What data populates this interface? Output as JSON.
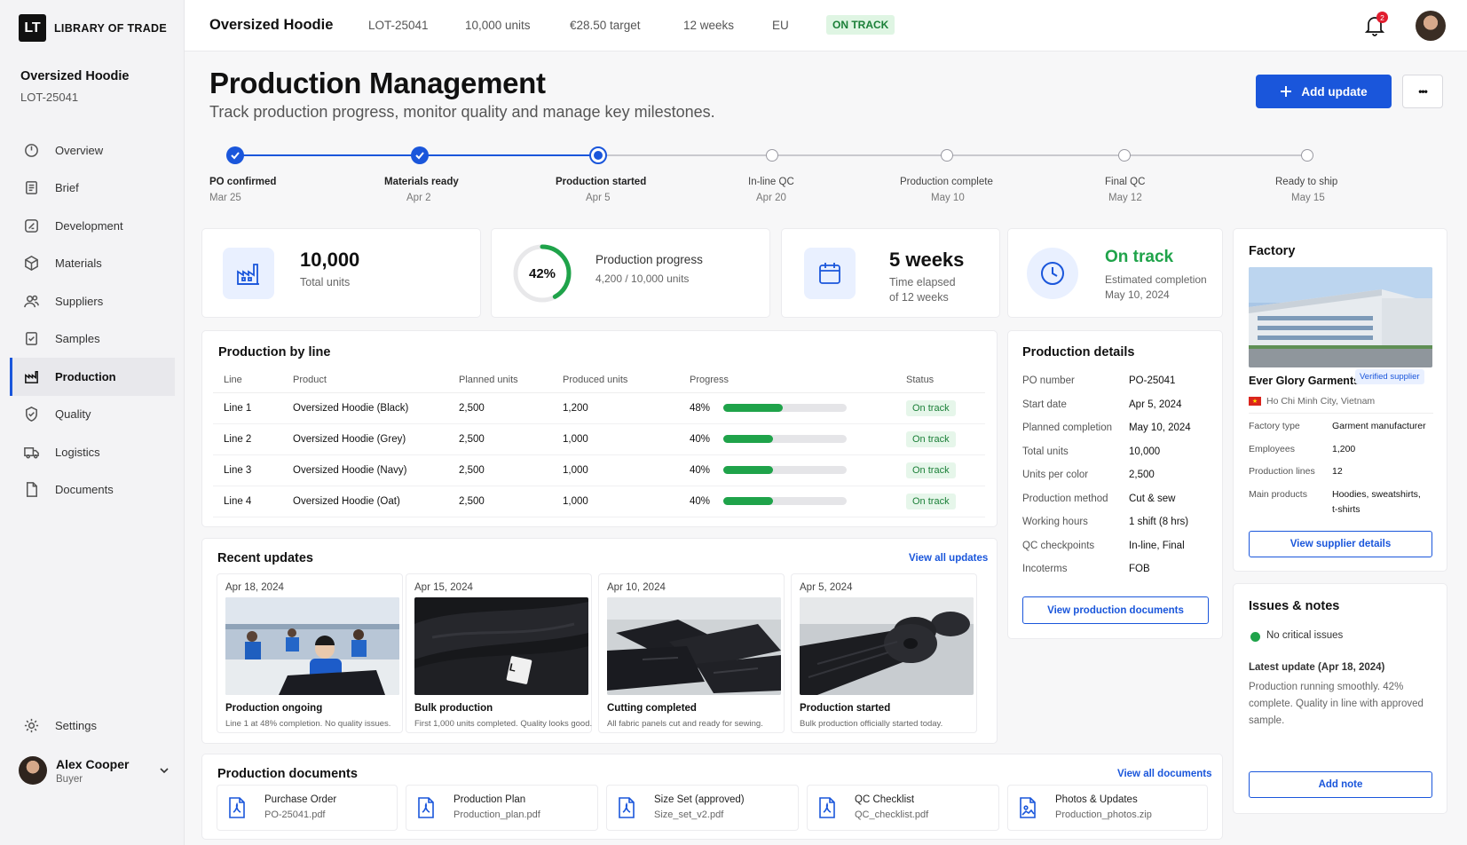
{
  "brand": {
    "mark": "LT",
    "name": "LIBRARY OF TRADE"
  },
  "project": {
    "name": "Oversized Hoodie",
    "code": "LOT-25041"
  },
  "sidebar": {
    "items": [
      {
        "label": "Overview",
        "icon": "overview-icon"
      },
      {
        "label": "Brief",
        "icon": "brief-icon"
      },
      {
        "label": "Development",
        "icon": "development-icon"
      },
      {
        "label": "Materials",
        "icon": "materials-icon"
      },
      {
        "label": "Suppliers",
        "icon": "suppliers-icon"
      },
      {
        "label": "Samples",
        "icon": "samples-icon"
      },
      {
        "label": "Production",
        "icon": "production-icon",
        "active": true
      },
      {
        "label": "Quality",
        "icon": "quality-icon"
      },
      {
        "label": "Logistics",
        "icon": "logistics-icon"
      },
      {
        "label": "Documents",
        "icon": "documents-icon"
      }
    ],
    "settings": "Settings",
    "user": {
      "name": "Alex Cooper",
      "role": "Buyer"
    }
  },
  "topbar": {
    "title": "Oversized Hoodie",
    "code": "LOT-25041",
    "units": "10,000 units",
    "target": "€28.50 target",
    "duration": "12 weeks",
    "region": "EU",
    "status": "ON TRACK",
    "notifications": "2"
  },
  "page": {
    "title": "Production Management",
    "subtitle": "Track production progress, monitor quality and manage key milestones.",
    "add_update": "Add update",
    "more": "•••"
  },
  "milestones": [
    {
      "label": "PO confirmed",
      "date": "Mar 25",
      "state": "done"
    },
    {
      "label": "Materials ready",
      "date": "Apr 2",
      "state": "done"
    },
    {
      "label": "Production started",
      "date": "Apr 5",
      "state": "current"
    },
    {
      "label": "In-line QC",
      "date": "Apr 20",
      "state": "todo"
    },
    {
      "label": "Production complete",
      "date": "May 10",
      "state": "todo"
    },
    {
      "label": "Final QC",
      "date": "May 12",
      "state": "todo"
    },
    {
      "label": "Ready to ship",
      "date": "May 15",
      "state": "todo"
    }
  ],
  "stats": {
    "total": {
      "value": "10,000",
      "label": "Total units"
    },
    "progress": {
      "percent": "42%",
      "fraction": 0.42,
      "label": "Production progress",
      "detail": "4,200 / 10,000 units"
    },
    "time": {
      "value": "5 weeks",
      "label1": "Time elapsed",
      "label2": "of 12 weeks"
    },
    "status": {
      "value": "On track",
      "label": "Estimated completion",
      "date": "May 10, 2024"
    }
  },
  "production_by_line": {
    "title": "Production by line",
    "headers": [
      "Line",
      "Product",
      "Planned units",
      "Produced units",
      "Progress",
      "Status"
    ],
    "rows": [
      {
        "line": "Line 1",
        "product": "Oversized Hoodie (Black)",
        "planned": "2,500",
        "produced": "1,200",
        "progress": "48%",
        "fraction": 0.48,
        "status": "On track"
      },
      {
        "line": "Line 2",
        "product": "Oversized Hoodie (Grey)",
        "planned": "2,500",
        "produced": "1,000",
        "progress": "40%",
        "fraction": 0.4,
        "status": "On track"
      },
      {
        "line": "Line 3",
        "product": "Oversized Hoodie (Navy)",
        "planned": "2,500",
        "produced": "1,000",
        "progress": "40%",
        "fraction": 0.4,
        "status": "On track"
      },
      {
        "line": "Line 4",
        "product": "Oversized Hoodie (Oat)",
        "planned": "2,500",
        "produced": "1,000",
        "progress": "40%",
        "fraction": 0.4,
        "status": "On track"
      }
    ]
  },
  "recent_updates": {
    "title": "Recent updates",
    "view_all": "View all updates",
    "items": [
      {
        "date": "Apr 18, 2024",
        "title": "Production ongoing",
        "desc": "Line 1 at 48% completion. No quality issues."
      },
      {
        "date": "Apr 15, 2024",
        "title": "Bulk production",
        "desc": "First 1,000 units completed. Quality looks good.",
        "tag": "L"
      },
      {
        "date": "Apr 10, 2024",
        "title": "Cutting completed",
        "desc": "All fabric panels cut and ready for sewing."
      },
      {
        "date": "Apr 5, 2024",
        "title": "Production started",
        "desc": "Bulk production officially started today."
      }
    ]
  },
  "production_details": {
    "title": "Production details",
    "rows": [
      {
        "k": "PO number",
        "v": "PO-25041"
      },
      {
        "k": "Start date",
        "v": "Apr 5, 2024"
      },
      {
        "k": "Planned completion",
        "v": "May 10, 2024"
      },
      {
        "k": "Total units",
        "v": "10,000"
      },
      {
        "k": "Units per color",
        "v": "2,500"
      },
      {
        "k": "Production method",
        "v": "Cut & sew"
      },
      {
        "k": "Working hours",
        "v": "1 shift (8 hrs)"
      },
      {
        "k": "QC checkpoints",
        "v": "In-line, Final"
      },
      {
        "k": "Incoterms",
        "v": "FOB"
      }
    ],
    "button": "View production documents"
  },
  "factory": {
    "title": "Factory",
    "name": "Ever Glory Garments",
    "verified": "Verified supplier",
    "location": "Ho Chi Minh City, Vietnam",
    "rows": [
      {
        "k": "Factory type",
        "v": "Garment manufacturer"
      },
      {
        "k": "Employees",
        "v": "1,200"
      },
      {
        "k": "Production lines",
        "v": "12"
      },
      {
        "k": "Main products",
        "v1": "Hoodies, sweatshirts,",
        "v2": "t-shirts"
      }
    ],
    "button": "View supplier details"
  },
  "issues": {
    "title": "Issues & notes",
    "status": "No critical issues",
    "latest_title": "Latest update (Apr 18, 2024)",
    "latest_lines": [
      "Production running smoothly. 42%",
      "complete. Quality in line with approved",
      "sample."
    ],
    "button": "Add note"
  },
  "documents": {
    "title": "Production documents",
    "view_all": "View all documents",
    "items": [
      {
        "name": "Purchase Order",
        "file": "PO-25041.pdf"
      },
      {
        "name": "Production Plan",
        "file": "Production_plan.pdf"
      },
      {
        "name": "Size Set (approved)",
        "file": "Size_set_v2.pdf"
      },
      {
        "name": "QC Checklist",
        "file": "QC_checklist.pdf"
      },
      {
        "name": "Photos & Updates",
        "file": "Production_photos.zip"
      }
    ]
  },
  "colors": {
    "accent": "#1a56db",
    "success": "#1fa34a",
    "success_bg": "#e6f6ea",
    "danger": "#e11d2e"
  }
}
